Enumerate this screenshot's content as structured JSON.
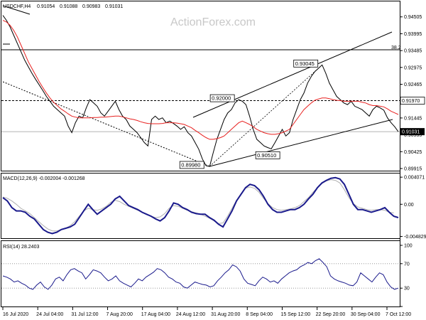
{
  "chart_data": [
    {
      "type": "line",
      "panel": "price",
      "symbol": "USDCHF,H4",
      "ohlc": [
        "0.91054",
        "0.91088",
        "0.90983",
        "0.91031"
      ],
      "watermark": "ActionForex.com",
      "ylim": [
        0.8985,
        0.9465
      ],
      "y_ticks": [
        "0.94505",
        "0.93995",
        "0.93485",
        "0.92975",
        "0.92465",
        "0.91955",
        "0.91445",
        "0.90935",
        "0.90425",
        "0.89915"
      ],
      "x_labels": [
        "16 Jul 2020",
        "24 Jul 04:00",
        "31 Jul 12:00",
        "7 Aug 20:00",
        "17 Aug 04:00",
        "24 Aug 12:00",
        "31 Aug 20:00",
        "8 Sep 04:00",
        "15 Sep 12:00",
        "22 Sep 20:00",
        "30 Sep 04:00",
        "7 Oct 12:00"
      ],
      "series": [
        {
          "values": [
            0.9455,
            0.944,
            0.942,
            0.9395,
            0.937,
            0.9345,
            0.932,
            0.93,
            0.928,
            0.9262,
            0.9245,
            0.9228,
            0.921,
            0.9195,
            0.918,
            0.917,
            0.916,
            0.915,
            0.912,
            0.91,
            0.913,
            0.915,
            0.9145,
            0.9175,
            0.92,
            0.919,
            0.918,
            0.916,
            0.915,
            0.9165,
            0.918,
            0.9195,
            0.917,
            0.915,
            0.914,
            0.912,
            0.911,
            0.91,
            0.9085,
            0.907,
            0.906,
            0.914,
            0.915,
            0.914,
            0.9145,
            0.913,
            0.9135,
            0.9128,
            0.912,
            0.911,
            0.9118,
            0.91,
            0.909,
            0.907,
            0.905,
            0.902,
            0.9,
            0.8998,
            0.904,
            0.908,
            0.911,
            0.914,
            0.916,
            0.917,
            0.919,
            0.92,
            0.9195,
            0.9185,
            0.915,
            0.911,
            0.908,
            0.907,
            0.906,
            0.9055,
            0.9051,
            0.907,
            0.909,
            0.911,
            0.909,
            0.91,
            0.914,
            0.917,
            0.92,
            0.922,
            0.925,
            0.927,
            0.9285,
            0.9295,
            0.9305,
            0.928,
            0.925,
            0.923,
            0.921,
            0.92,
            0.919,
            0.9185,
            0.9195,
            0.918,
            0.9175,
            0.917,
            0.916,
            0.915,
            0.917,
            0.918,
            0.9175,
            0.9168,
            0.9145,
            0.913,
            0.9118,
            0.9103
          ]
        },
        {
          "values": [
            0.944,
            0.9435,
            0.9425,
            0.941,
            0.939,
            0.9365,
            0.934,
            0.9315,
            0.9295,
            0.9275,
            0.9255,
            0.9237,
            0.922,
            0.9205,
            0.9192,
            0.9182,
            0.9172,
            0.9165,
            0.9157,
            0.915,
            0.9147,
            0.9145,
            0.9145,
            0.9145,
            0.9145,
            0.9146,
            0.9146,
            0.9147,
            0.9147,
            0.9148,
            0.9149,
            0.915,
            0.915,
            0.9148,
            0.9145,
            0.9142,
            0.914,
            0.9137,
            0.9133,
            0.913,
            0.9128,
            0.9127,
            0.9127,
            0.9127,
            0.9128,
            0.913,
            0.913,
            0.913,
            0.9129,
            0.9127,
            0.9125,
            0.912,
            0.9115,
            0.9107,
            0.91,
            0.9092,
            0.9085,
            0.908,
            0.908,
            0.9082,
            0.9085,
            0.909,
            0.91,
            0.911,
            0.912,
            0.913,
            0.9135,
            0.913,
            0.9125,
            0.9118,
            0.911,
            0.9105,
            0.91,
            0.9097,
            0.9095,
            0.9095,
            0.9097,
            0.91,
            0.9105,
            0.911,
            0.9125,
            0.914,
            0.9155,
            0.917,
            0.918,
            0.919,
            0.9198,
            0.9202,
            0.9205,
            0.9205,
            0.9203,
            0.92,
            0.9198,
            0.9197,
            0.9195,
            0.9195,
            0.9195,
            0.9195,
            0.9195,
            0.9192,
            0.919,
            0.9185,
            0.9182,
            0.9182,
            0.918,
            0.9178,
            0.9172,
            0.9165,
            0.916,
            0.9155
          ]
        }
      ],
      "levels": [
        "0.91970",
        "0.91031"
      ],
      "fib_label": "38.2",
      "annotations": [
        "0.93045",
        "0.92000",
        "0.90510",
        "0.89980"
      ],
      "colors": {
        "price": "#000000",
        "ma": "#e8201f",
        "current_tag": "#000000",
        "label_fill": "#ffffff"
      },
      "grid": false
    },
    {
      "type": "line",
      "panel": "macd",
      "title": "MACD(12,26,9) -0.002004 -0.001268",
      "ylim": [
        -0.0051,
        0.0043
      ],
      "y_ticks": [
        "0.004071",
        "0.00",
        "-0.004829"
      ],
      "series": [
        {
          "values": [
            0.001,
            0.0005,
            -0.0005,
            -0.001,
            -0.001,
            -0.0012,
            -0.0018,
            -0.0022,
            -0.003,
            -0.0038,
            -0.0042,
            -0.0044,
            -0.0042,
            -0.0038,
            -0.0036,
            -0.0034,
            -0.003,
            -0.002,
            -0.001,
            0.0,
            -0.0008,
            -0.0015,
            -0.001,
            -0.0005,
            0.0,
            0.0008,
            0.0012,
            0.0005,
            -0.0002,
            -0.0005,
            -0.0008,
            -0.0012,
            -0.0015,
            -0.0018,
            -0.0022,
            -0.0025,
            -0.002,
            -0.001,
            0.0002,
            0.0,
            -0.0005,
            -0.0008,
            -0.0012,
            -0.0014,
            -0.0015,
            -0.0015,
            -0.002,
            -0.0024,
            -0.003,
            -0.0034,
            -0.0022,
            -0.001,
            0.0005,
            0.0015,
            0.0025,
            0.003,
            0.0028,
            0.0022,
            0.0012,
            0.0,
            -0.0008,
            -0.0012,
            -0.0012,
            -0.001,
            -0.0008,
            -0.0008,
            -0.0005,
            0.0,
            0.0008,
            0.0015,
            0.0025,
            0.0032,
            0.0036,
            0.0039,
            0.004,
            0.0038,
            0.003,
            0.0015,
            0.0,
            -0.0008,
            -0.0008,
            -0.001,
            -0.0012,
            -0.001,
            -0.0008,
            -0.0005,
            -0.0012,
            -0.0018,
            -0.002
          ]
        },
        {
          "values": [
            0.0011,
            0.0009,
            0.0005,
            0.0,
            -0.0006,
            -0.001,
            -0.0014,
            -0.002,
            -0.0026,
            -0.0032,
            -0.0037,
            -0.004,
            -0.004,
            -0.0038,
            -0.0036,
            -0.0032,
            -0.0026,
            -0.0018,
            -0.001,
            -0.0006,
            -0.0008,
            -0.0009,
            -0.0007,
            -0.0003,
            0.0003,
            0.0006,
            0.0004,
            0.0,
            -0.0003,
            -0.0006,
            -0.0009,
            -0.0012,
            -0.0015,
            -0.0018,
            -0.002,
            -0.0019,
            -0.0014,
            -0.0006,
            -0.0002,
            -0.0003,
            -0.0006,
            -0.0009,
            -0.0011,
            -0.0013,
            -0.0015,
            -0.0018,
            -0.0021,
            -0.0025,
            -0.0029,
            -0.0028,
            -0.0018,
            -0.0006,
            0.0006,
            0.0016,
            0.0024,
            0.0026,
            0.0024,
            0.0018,
            0.0009,
            0.0001,
            -0.0005,
            -0.0008,
            -0.0009,
            -0.0008,
            -0.0007,
            -0.0005,
            -0.0002,
            0.0004,
            0.001,
            0.0018,
            0.0025,
            0.0031,
            0.0035,
            0.0037,
            0.0036,
            0.0032,
            0.0022,
            0.001,
            0.0001,
            -0.0004,
            -0.0006,
            -0.0008,
            -0.0009,
            -0.0008,
            -0.0008,
            -0.0009,
            -0.0012,
            -0.0013
          ]
        }
      ],
      "colors": {
        "macd": "#1a1a8c",
        "signal": "#b0b0b0"
      },
      "grid": false
    },
    {
      "type": "line",
      "panel": "rsi",
      "title": "RSI(14) 28.2403",
      "ylim": [
        0,
        100
      ],
      "y_ticks": [
        "100",
        "70",
        "30",
        "0"
      ],
      "levels": [
        70,
        30
      ],
      "series": [
        {
          "values": [
            50,
            48,
            45,
            40,
            42,
            38,
            35,
            30,
            28,
            35,
            40,
            32,
            28,
            35,
            45,
            48,
            42,
            52,
            60,
            62,
            58,
            55,
            45,
            52,
            60,
            58,
            55,
            48,
            42,
            45,
            50,
            42,
            38,
            35,
            32,
            38,
            45,
            42,
            48,
            52,
            56,
            62,
            60,
            55,
            48,
            45,
            40,
            38,
            32,
            30,
            35,
            40,
            38,
            36,
            35,
            32,
            34,
            42,
            48,
            55,
            60,
            68,
            65,
            58,
            45,
            38,
            36,
            34,
            42,
            48,
            45,
            40,
            42,
            38,
            45,
            50,
            55,
            58,
            60,
            65,
            68,
            72,
            70,
            75,
            78,
            72,
            65,
            50,
            45,
            42,
            40,
            38,
            35,
            34,
            40,
            55,
            50,
            45,
            40,
            48,
            55,
            52,
            40,
            32,
            28,
            30
          ]
        }
      ],
      "colors": {
        "rsi": "#1a1a8c",
        "level": "#888888"
      },
      "grid": false
    }
  ]
}
